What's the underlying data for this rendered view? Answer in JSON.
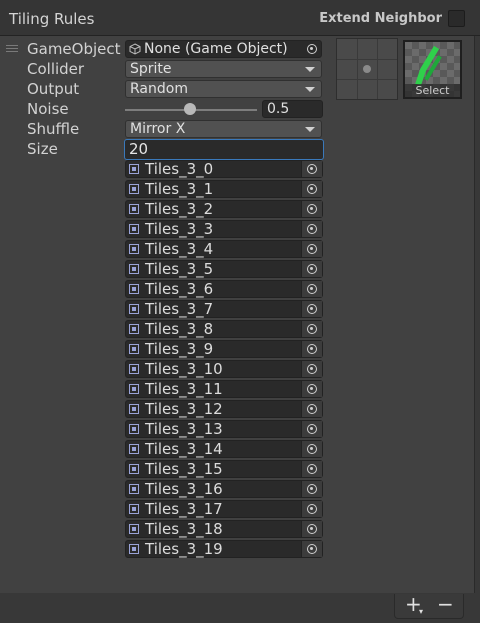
{
  "header": {
    "title": "Tiling Rules",
    "extend_neighbor_label": "Extend Neighbor"
  },
  "rule": {
    "gameobject": {
      "label": "GameObject",
      "value": "None (Game Object)"
    },
    "collider": {
      "label": "Collider",
      "value": "Sprite"
    },
    "output": {
      "label": "Output",
      "value": "Random"
    },
    "noise": {
      "label": "Noise",
      "value": "0.5",
      "level": 0.5
    },
    "shuffle": {
      "label": "Shuffle",
      "value": "Mirror X"
    },
    "size": {
      "label": "Size",
      "value": "20"
    }
  },
  "sprites": [
    "Tiles_3_0",
    "Tiles_3_1",
    "Tiles_3_2",
    "Tiles_3_3",
    "Tiles_3_4",
    "Tiles_3_5",
    "Tiles_3_6",
    "Tiles_3_7",
    "Tiles_3_8",
    "Tiles_3_9",
    "Tiles_3_10",
    "Tiles_3_11",
    "Tiles_3_12",
    "Tiles_3_13",
    "Tiles_3_14",
    "Tiles_3_15",
    "Tiles_3_16",
    "Tiles_3_17",
    "Tiles_3_18",
    "Tiles_3_19"
  ],
  "preview": {
    "select_label": "Select"
  },
  "footer": {
    "add_label": "+",
    "remove_label": "−"
  },
  "colors": {
    "accent": "#3a79bb",
    "sprite_green": "#2fd04b"
  }
}
